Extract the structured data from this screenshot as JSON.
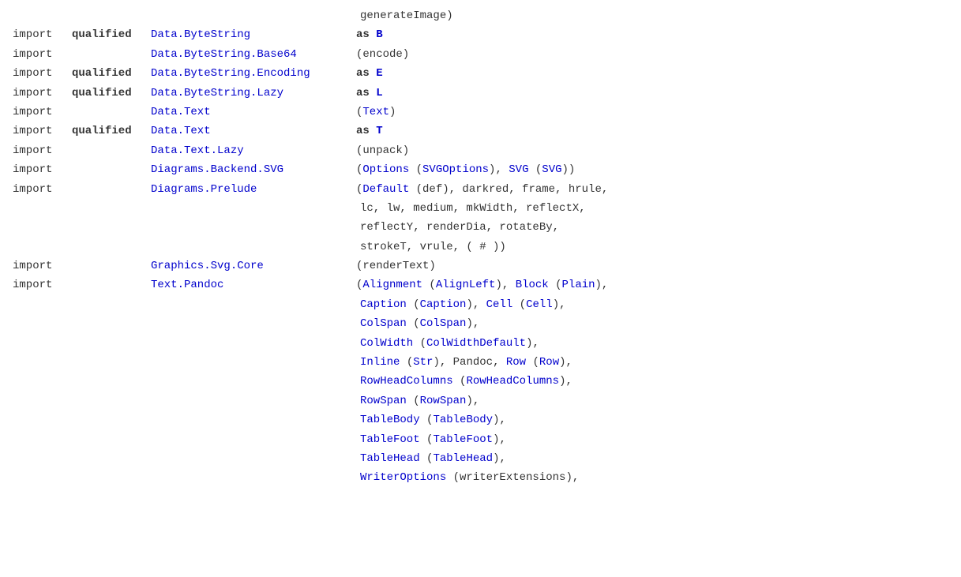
{
  "lines": [
    {
      "id": "line-generateImage",
      "indent": 456,
      "content": "generateImage)"
    },
    {
      "id": "line-bytestring",
      "import": "import",
      "qualified": "qualified",
      "module": "Data.ByteString",
      "moduleHref": "#",
      "as": "as",
      "alias": "B",
      "rest": ""
    },
    {
      "id": "line-bytestring-base64",
      "import": "import",
      "qualified": "",
      "module": "Data.ByteString.Base64",
      "moduleHref": "#",
      "as": "",
      "alias": "",
      "rest": "(encode)"
    },
    {
      "id": "line-bytestring-encoding",
      "import": "import",
      "qualified": "qualified",
      "module": "Data.ByteString.Encoding",
      "moduleHref": "#",
      "as": "as",
      "alias": "E",
      "rest": ""
    },
    {
      "id": "line-bytestring-lazy",
      "import": "import",
      "qualified": "qualified",
      "module": "Data.ByteString.Lazy",
      "moduleHref": "#",
      "as": "as",
      "alias": "L",
      "rest": ""
    },
    {
      "id": "line-data-text",
      "import": "import",
      "qualified": "",
      "module": "Data.Text",
      "moduleHref": "#",
      "as": "",
      "alias": "",
      "rest": "(Text)"
    },
    {
      "id": "line-data-text-qualified",
      "import": "import",
      "qualified": "qualified",
      "module": "Data.Text",
      "moduleHref": "#",
      "as": "as",
      "alias": "T",
      "rest": ""
    },
    {
      "id": "line-data-text-lazy",
      "import": "import",
      "qualified": "",
      "module": "Data.Text.Lazy",
      "moduleHref": "#",
      "as": "",
      "alias": "",
      "rest": "(unpack)"
    },
    {
      "id": "line-diagrams-backend-svg",
      "import": "import",
      "qualified": "",
      "module": "Diagrams.Backend.SVG",
      "moduleHref": "#",
      "as": "",
      "alias": "",
      "rest_parts": [
        {
          "text": "(",
          "type": "plain"
        },
        {
          "text": "Options",
          "type": "link"
        },
        {
          "text": " (",
          "type": "plain"
        },
        {
          "text": "SVGOptions",
          "type": "link"
        },
        {
          "text": "), ",
          "type": "plain"
        },
        {
          "text": "SVG",
          "type": "link"
        },
        {
          "text": " (",
          "type": "plain"
        },
        {
          "text": "SVG",
          "type": "link"
        },
        {
          "text": "))",
          "type": "plain"
        }
      ]
    },
    {
      "id": "line-diagrams-prelude",
      "import": "import",
      "qualified": "",
      "module": "Diagrams.Prelude",
      "moduleHref": "#",
      "as": "",
      "alias": "",
      "rest_parts": [
        {
          "text": "(",
          "type": "plain"
        },
        {
          "text": "Default",
          "type": "link"
        },
        {
          "text": " (def), darkred, frame, hrule,",
          "type": "plain"
        }
      ]
    },
    {
      "id": "line-diagrams-prelude-cont1",
      "continuation": true,
      "content": " lc, lw, medium, mkWidth, reflectX,"
    },
    {
      "id": "line-diagrams-prelude-cont2",
      "continuation": true,
      "content": " reflectY, renderDia, rotateBy,"
    },
    {
      "id": "line-diagrams-prelude-cont3",
      "continuation": true,
      "content": " strokeT, vrule, ( # ))"
    },
    {
      "id": "line-graphics-svg-core",
      "import": "import",
      "qualified": "",
      "module": "Graphics.Svg.Core",
      "moduleHref": "#",
      "as": "",
      "alias": "",
      "rest": "(renderText)"
    },
    {
      "id": "line-text-pandoc",
      "import": "import",
      "qualified": "",
      "module": "Text.Pandoc",
      "moduleHref": "#",
      "as": "",
      "alias": "",
      "rest_parts": [
        {
          "text": "(",
          "type": "plain"
        },
        {
          "text": "Alignment",
          "type": "link"
        },
        {
          "text": " (",
          "type": "plain"
        },
        {
          "text": "AlignLeft",
          "type": "link"
        },
        {
          "text": "), ",
          "type": "plain"
        },
        {
          "text": "Block",
          "type": "link"
        },
        {
          "text": " (",
          "type": "plain"
        },
        {
          "text": "Plain",
          "type": "link"
        },
        {
          "text": "),",
          "type": "plain"
        }
      ]
    },
    {
      "id": "line-pandoc-cont1",
      "continuation": true,
      "parts": [
        {
          "text": "Caption",
          "type": "link"
        },
        {
          "text": " (",
          "type": "plain"
        },
        {
          "text": "Caption",
          "type": "link"
        },
        {
          "text": "), ",
          "type": "plain"
        },
        {
          "text": "Cell",
          "type": "link"
        },
        {
          "text": " (",
          "type": "plain"
        },
        {
          "text": "Cell",
          "type": "link"
        },
        {
          "text": "),",
          "type": "plain"
        }
      ]
    },
    {
      "id": "line-pandoc-cont2",
      "continuation": true,
      "parts": [
        {
          "text": "ColSpan",
          "type": "link"
        },
        {
          "text": " (",
          "type": "plain"
        },
        {
          "text": "ColSpan",
          "type": "link"
        },
        {
          "text": "),",
          "type": "plain"
        }
      ]
    },
    {
      "id": "line-pandoc-cont3",
      "continuation": true,
      "parts": [
        {
          "text": "ColWidth",
          "type": "link"
        },
        {
          "text": " (",
          "type": "plain"
        },
        {
          "text": "ColWidthDefault",
          "type": "link"
        },
        {
          "text": "),",
          "type": "plain"
        }
      ]
    },
    {
      "id": "line-pandoc-cont4",
      "continuation": true,
      "parts": [
        {
          "text": "Inline",
          "type": "link"
        },
        {
          "text": " (",
          "type": "plain"
        },
        {
          "text": "Str",
          "type": "link"
        },
        {
          "text": "), Pandoc, ",
          "type": "plain"
        },
        {
          "text": "Row",
          "type": "link"
        },
        {
          "text": " (",
          "type": "plain"
        },
        {
          "text": "Row",
          "type": "link"
        },
        {
          "text": "),",
          "type": "plain"
        }
      ]
    },
    {
      "id": "line-pandoc-cont5",
      "continuation": true,
      "parts": [
        {
          "text": "RowHeadColumns",
          "type": "link"
        },
        {
          "text": " (",
          "type": "plain"
        },
        {
          "text": "RowHeadColumns",
          "type": "link"
        },
        {
          "text": "),",
          "type": "plain"
        }
      ]
    },
    {
      "id": "line-pandoc-cont6",
      "continuation": true,
      "parts": [
        {
          "text": "RowSpan",
          "type": "link"
        },
        {
          "text": " (",
          "type": "plain"
        },
        {
          "text": "RowSpan",
          "type": "link"
        },
        {
          "text": "),",
          "type": "plain"
        }
      ]
    },
    {
      "id": "line-pandoc-cont7",
      "continuation": true,
      "parts": [
        {
          "text": "TableBody",
          "type": "link"
        },
        {
          "text": " (",
          "type": "plain"
        },
        {
          "text": "TableBody",
          "type": "link"
        },
        {
          "text": "),",
          "type": "plain"
        }
      ]
    },
    {
      "id": "line-pandoc-cont8",
      "continuation": true,
      "parts": [
        {
          "text": "TableFoot",
          "type": "link"
        },
        {
          "text": " (",
          "type": "plain"
        },
        {
          "text": "TableFoot",
          "type": "link"
        },
        {
          "text": "),",
          "type": "plain"
        }
      ]
    },
    {
      "id": "line-pandoc-cont9",
      "continuation": true,
      "parts": [
        {
          "text": "TableHead",
          "type": "link"
        },
        {
          "text": " (",
          "type": "plain"
        },
        {
          "text": "TableHead",
          "type": "link"
        },
        {
          "text": "),",
          "type": "plain"
        }
      ]
    },
    {
      "id": "line-pandoc-cont10",
      "continuation": true,
      "parts": [
        {
          "text": "WriterOptions",
          "type": "link"
        },
        {
          "text": " (writerExtensions),",
          "type": "plain"
        }
      ]
    }
  ],
  "colors": {
    "link": "#0000cc",
    "keyword": "#000000",
    "plain": "#333333",
    "background": "#ffffff"
  }
}
